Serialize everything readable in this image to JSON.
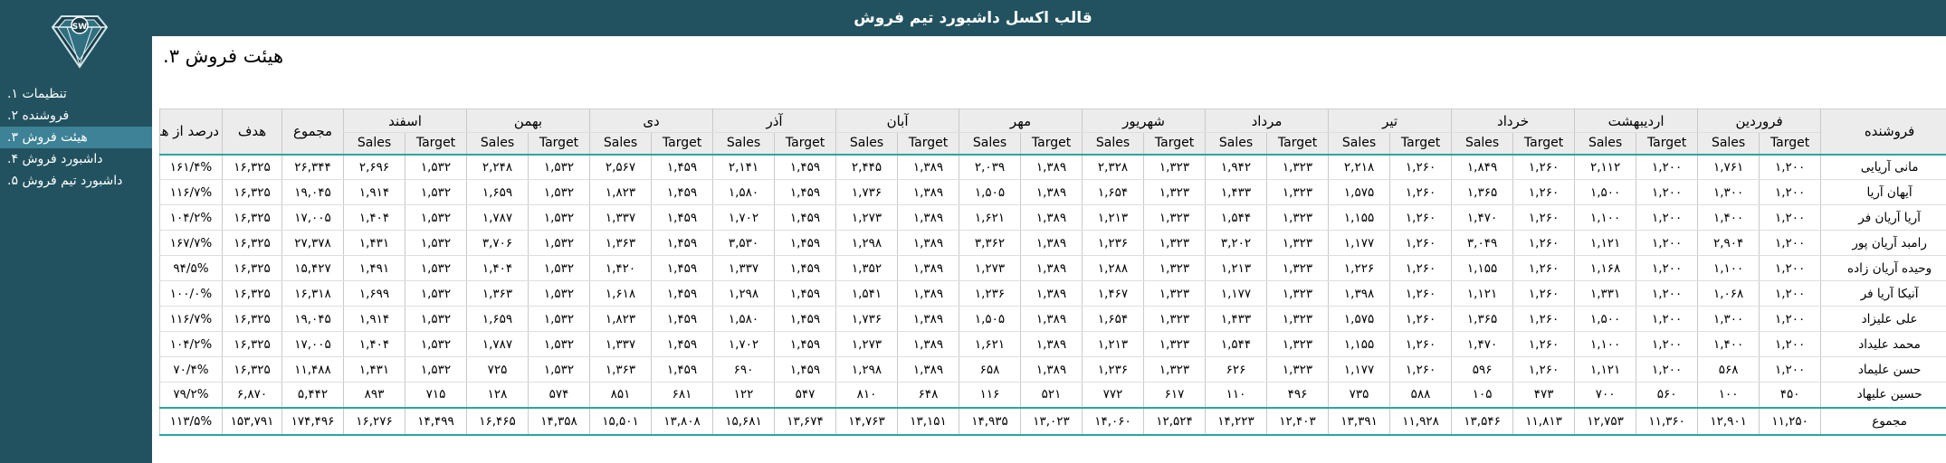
{
  "app": {
    "title": "قالب اکسل داشبورد تیم فروش",
    "logo_text": "SW",
    "colors": {
      "header": "#22525f",
      "sidebar": "#22525f",
      "active_item": "#3d8296",
      "accent_line": "#2aa6a0"
    }
  },
  "sidebar": {
    "items": [
      {
        "label": "تنظیمات",
        "num": "۱."
      },
      {
        "label": "فروشنده",
        "num": "۲."
      },
      {
        "label": "هیئت فروش",
        "num": "۳."
      },
      {
        "label": "داشبورد فروش",
        "num": "۴."
      },
      {
        "label": "داشبورد تیم فروش",
        "num": "۵."
      }
    ],
    "active_index": 2
  },
  "page": {
    "title": "هیئت فروش ۳."
  },
  "table": {
    "seller_header": "فروشنده",
    "total_header": "مجموع",
    "target_header": "هدف",
    "percent_header": "درصد از هدف",
    "target_sub": "Target",
    "sales_sub": "Sales",
    "months": [
      "فروردین",
      "اردیبهشت",
      "خرداد",
      "تیر",
      "مرداد",
      "شهریور",
      "مهر",
      "آبان",
      "آذر",
      "دی",
      "بهمن",
      "اسفند"
    ],
    "rows": [
      {
        "name": "مانی آریایی",
        "m": [
          [
            "۱,۲۰۰",
            "۱,۷۶۱"
          ],
          [
            "۱,۲۰۰",
            "۲,۱۱۲"
          ],
          [
            "۱,۲۶۰",
            "۱,۸۴۹"
          ],
          [
            "۱,۲۶۰",
            "۲,۲۱۸"
          ],
          [
            "۱,۳۲۳",
            "۱,۹۴۲"
          ],
          [
            "۱,۳۲۳",
            "۲,۳۲۸"
          ],
          [
            "۱,۳۸۹",
            "۲,۰۳۹"
          ],
          [
            "۱,۳۸۹",
            "۲,۴۴۵"
          ],
          [
            "۱,۴۵۹",
            "۲,۱۴۱"
          ],
          [
            "۱,۴۵۹",
            "۲,۵۶۷"
          ],
          [
            "۱,۵۳۲",
            "۲,۲۴۸"
          ],
          [
            "۱,۵۳۲",
            "۲,۶۹۶"
          ]
        ],
        "total": "۲۶,۳۴۴",
        "target": "۱۶,۳۲۵",
        "pct": "۱۶۱/۴%"
      },
      {
        "name": "آیهان آریا",
        "m": [
          [
            "۱,۲۰۰",
            "۱,۳۰۰"
          ],
          [
            "۱,۲۰۰",
            "۱,۵۰۰"
          ],
          [
            "۱,۲۶۰",
            "۱,۳۶۵"
          ],
          [
            "۱,۲۶۰",
            "۱,۵۷۵"
          ],
          [
            "۱,۳۲۳",
            "۱,۴۳۳"
          ],
          [
            "۱,۳۲۳",
            "۱,۶۵۴"
          ],
          [
            "۱,۳۸۹",
            "۱,۵۰۵"
          ],
          [
            "۱,۳۸۹",
            "۱,۷۳۶"
          ],
          [
            "۱,۴۵۹",
            "۱,۵۸۰"
          ],
          [
            "۱,۴۵۹",
            "۱,۸۲۳"
          ],
          [
            "۱,۵۳۲",
            "۱,۶۵۹"
          ],
          [
            "۱,۵۳۲",
            "۱,۹۱۴"
          ]
        ],
        "total": "۱۹,۰۴۵",
        "target": "۱۶,۳۲۵",
        "pct": "۱۱۶/۷%"
      },
      {
        "name": "آریا آریان فر",
        "m": [
          [
            "۱,۲۰۰",
            "۱,۴۰۰"
          ],
          [
            "۱,۲۰۰",
            "۱,۱۰۰"
          ],
          [
            "۱,۲۶۰",
            "۱,۴۷۰"
          ],
          [
            "۱,۲۶۰",
            "۱,۱۵۵"
          ],
          [
            "۱,۳۲۳",
            "۱,۵۴۴"
          ],
          [
            "۱,۳۲۳",
            "۱,۲۱۳"
          ],
          [
            "۱,۳۸۹",
            "۱,۶۲۱"
          ],
          [
            "۱,۳۸۹",
            "۱,۲۷۳"
          ],
          [
            "۱,۴۵۹",
            "۱,۷۰۲"
          ],
          [
            "۱,۴۵۹",
            "۱,۳۳۷"
          ],
          [
            "۱,۵۳۲",
            "۱,۷۸۷"
          ],
          [
            "۱,۵۳۲",
            "۱,۴۰۴"
          ]
        ],
        "total": "۱۷,۰۰۵",
        "target": "۱۶,۳۲۵",
        "pct": "۱۰۴/۲%"
      },
      {
        "name": "رامبد آریان پور",
        "m": [
          [
            "۱,۲۰۰",
            "۲,۹۰۴"
          ],
          [
            "۱,۲۰۰",
            "۱,۱۲۱"
          ],
          [
            "۱,۲۶۰",
            "۳,۰۴۹"
          ],
          [
            "۱,۲۶۰",
            "۱,۱۷۷"
          ],
          [
            "۱,۳۲۳",
            "۳,۲۰۲"
          ],
          [
            "۱,۳۲۳",
            "۱,۲۳۶"
          ],
          [
            "۱,۳۸۹",
            "۳,۳۶۲"
          ],
          [
            "۱,۳۸۹",
            "۱,۲۹۸"
          ],
          [
            "۱,۴۵۹",
            "۳,۵۳۰"
          ],
          [
            "۱,۴۵۹",
            "۱,۳۶۳"
          ],
          [
            "۱,۵۳۲",
            "۳,۷۰۶"
          ],
          [
            "۱,۵۳۲",
            "۱,۴۳۱"
          ]
        ],
        "total": "۲۷,۳۷۸",
        "target": "۱۶,۳۲۵",
        "pct": "۱۶۷/۷%"
      },
      {
        "name": "وحیده آریان زاده",
        "m": [
          [
            "۱,۲۰۰",
            "۱,۱۰۰"
          ],
          [
            "۱,۲۰۰",
            "۱,۱۶۸"
          ],
          [
            "۱,۲۶۰",
            "۱,۱۵۵"
          ],
          [
            "۱,۲۶۰",
            "۱,۲۲۶"
          ],
          [
            "۱,۳۲۳",
            "۱,۲۱۳"
          ],
          [
            "۱,۳۲۳",
            "۱,۲۸۸"
          ],
          [
            "۱,۳۸۹",
            "۱,۲۷۳"
          ],
          [
            "۱,۳۸۹",
            "۱,۳۵۲"
          ],
          [
            "۱,۴۵۹",
            "۱,۳۳۷"
          ],
          [
            "۱,۴۵۹",
            "۱,۴۲۰"
          ],
          [
            "۱,۵۳۲",
            "۱,۴۰۴"
          ],
          [
            "۱,۵۳۲",
            "۱,۴۹۱"
          ]
        ],
        "total": "۱۵,۴۲۷",
        "target": "۱۶,۳۲۵",
        "pct": "۹۴/۵%"
      },
      {
        "name": "آنیکا آریا فر",
        "m": [
          [
            "۱,۲۰۰",
            "۱,۰۶۸"
          ],
          [
            "۱,۲۰۰",
            "۱,۳۳۱"
          ],
          [
            "۱,۲۶۰",
            "۱,۱۲۱"
          ],
          [
            "۱,۲۶۰",
            "۱,۳۹۸"
          ],
          [
            "۱,۳۲۳",
            "۱,۱۷۷"
          ],
          [
            "۱,۳۲۳",
            "۱,۴۶۷"
          ],
          [
            "۱,۳۸۹",
            "۱,۲۳۶"
          ],
          [
            "۱,۳۸۹",
            "۱,۵۴۱"
          ],
          [
            "۱,۴۵۹",
            "۱,۲۹۸"
          ],
          [
            "۱,۴۵۹",
            "۱,۶۱۸"
          ],
          [
            "۱,۵۳۲",
            "۱,۳۶۳"
          ],
          [
            "۱,۵۳۲",
            "۱,۶۹۹"
          ]
        ],
        "total": "۱۶,۳۱۸",
        "target": "۱۶,۳۲۵",
        "pct": "۱۰۰/۰%"
      },
      {
        "name": "علی علیزاد",
        "m": [
          [
            "۱,۲۰۰",
            "۱,۳۰۰"
          ],
          [
            "۱,۲۰۰",
            "۱,۵۰۰"
          ],
          [
            "۱,۲۶۰",
            "۱,۳۶۵"
          ],
          [
            "۱,۲۶۰",
            "۱,۵۷۵"
          ],
          [
            "۱,۳۲۳",
            "۱,۴۳۳"
          ],
          [
            "۱,۳۲۳",
            "۱,۶۵۴"
          ],
          [
            "۱,۳۸۹",
            "۱,۵۰۵"
          ],
          [
            "۱,۳۸۹",
            "۱,۷۳۶"
          ],
          [
            "۱,۴۵۹",
            "۱,۵۸۰"
          ],
          [
            "۱,۴۵۹",
            "۱,۸۲۳"
          ],
          [
            "۱,۵۳۲",
            "۱,۶۵۹"
          ],
          [
            "۱,۵۳۲",
            "۱,۹۱۴"
          ]
        ],
        "total": "۱۹,۰۴۵",
        "target": "۱۶,۳۲۵",
        "pct": "۱۱۶/۷%"
      },
      {
        "name": "محمد علیداد",
        "m": [
          [
            "۱,۲۰۰",
            "۱,۴۰۰"
          ],
          [
            "۱,۲۰۰",
            "۱,۱۰۰"
          ],
          [
            "۱,۲۶۰",
            "۱,۴۷۰"
          ],
          [
            "۱,۲۶۰",
            "۱,۱۵۵"
          ],
          [
            "۱,۳۲۳",
            "۱,۵۴۴"
          ],
          [
            "۱,۳۲۳",
            "۱,۲۱۳"
          ],
          [
            "۱,۳۸۹",
            "۱,۶۲۱"
          ],
          [
            "۱,۳۸۹",
            "۱,۲۷۳"
          ],
          [
            "۱,۴۵۹",
            "۱,۷۰۲"
          ],
          [
            "۱,۴۵۹",
            "۱,۳۳۷"
          ],
          [
            "۱,۵۳۲",
            "۱,۷۸۷"
          ],
          [
            "۱,۵۳۲",
            "۱,۴۰۴"
          ]
        ],
        "total": "۱۷,۰۰۵",
        "target": "۱۶,۳۲۵",
        "pct": "۱۰۴/۲%"
      },
      {
        "name": "حسن علیماد",
        "m": [
          [
            "۱,۲۰۰",
            "۵۶۸"
          ],
          [
            "۱,۲۰۰",
            "۱,۱۲۱"
          ],
          [
            "۱,۲۶۰",
            "۵۹۶"
          ],
          [
            "۱,۲۶۰",
            "۱,۱۷۷"
          ],
          [
            "۱,۳۲۳",
            "۶۲۶"
          ],
          [
            "۱,۳۲۳",
            "۱,۲۳۶"
          ],
          [
            "۱,۳۸۹",
            "۶۵۸"
          ],
          [
            "۱,۳۸۹",
            "۱,۲۹۸"
          ],
          [
            "۱,۴۵۹",
            "۶۹۰"
          ],
          [
            "۱,۴۵۹",
            "۱,۳۶۳"
          ],
          [
            "۱,۵۳۲",
            "۷۲۵"
          ],
          [
            "۱,۵۳۲",
            "۱,۴۳۱"
          ]
        ],
        "total": "۱۱,۴۸۸",
        "target": "۱۶,۳۲۵",
        "pct": "۷۰/۴%"
      },
      {
        "name": "حسین علیهاد",
        "m": [
          [
            "۴۵۰",
            "۱۰۰"
          ],
          [
            "۵۶۰",
            "۷۰۰"
          ],
          [
            "۴۷۳",
            "۱۰۵"
          ],
          [
            "۵۸۸",
            "۷۳۵"
          ],
          [
            "۴۹۶",
            "۱۱۰"
          ],
          [
            "۶۱۷",
            "۷۷۲"
          ],
          [
            "۵۲۱",
            "۱۱۶"
          ],
          [
            "۶۴۸",
            "۸۱۰"
          ],
          [
            "۵۴۷",
            "۱۲۲"
          ],
          [
            "۶۸۱",
            "۸۵۱"
          ],
          [
            "۵۷۴",
            "۱۲۸"
          ],
          [
            "۷۱۵",
            "۸۹۳"
          ]
        ],
        "total": "۵,۴۴۲",
        "target": "۶,۸۷۰",
        "pct": "۷۹/۲%"
      }
    ],
    "total_row": {
      "name": "مجموع",
      "m": [
        [
          "۱۱,۲۵۰",
          "۱۲,۹۰۱"
        ],
        [
          "۱۱,۳۶۰",
          "۱۲,۷۵۳"
        ],
        [
          "۱۱,۸۱۳",
          "۱۳,۵۴۶"
        ],
        [
          "۱۱,۹۲۸",
          "۱۳,۳۹۱"
        ],
        [
          "۱۲,۴۰۳",
          "۱۴,۲۲۳"
        ],
        [
          "۱۲,۵۲۴",
          "۱۴,۰۶۰"
        ],
        [
          "۱۳,۰۲۳",
          "۱۴,۹۳۵"
        ],
        [
          "۱۳,۱۵۱",
          "۱۴,۷۶۳"
        ],
        [
          "۱۳,۶۷۴",
          "۱۵,۶۸۱"
        ],
        [
          "۱۳,۸۰۸",
          "۱۵,۵۰۱"
        ],
        [
          "۱۴,۳۵۸",
          "۱۶,۴۶۵"
        ],
        [
          "۱۴,۴۹۹",
          "۱۶,۲۷۶"
        ]
      ],
      "total": "۱۷۴,۴۹۶",
      "target": "۱۵۳,۷۹۱",
      "pct": "۱۱۳/۵%"
    }
  }
}
